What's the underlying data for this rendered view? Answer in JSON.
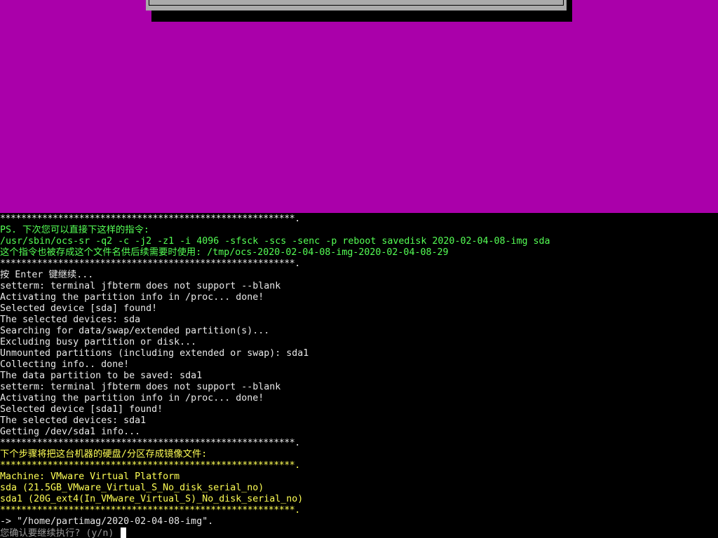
{
  "colors": {
    "dialog_background": "#aa00aa",
    "dialog_box": "#aaaaaa",
    "white": "#e8e8e8",
    "green": "#55ff55",
    "yellow": "#ffff55",
    "dim": "#9a9a9a"
  },
  "terminal": {
    "lines": [
      {
        "text": "********************************************************.",
        "color": "white"
      },
      {
        "text": "PS. 下次您可以直接下这样的指令:",
        "color": "green"
      },
      {
        "text": "/usr/sbin/ocs-sr -q2 -c -j2 -z1 -i 4096 -sfsck -scs -senc -p reboot savedisk 2020-02-04-08-img sda",
        "color": "green"
      },
      {
        "text": "这个指令也被存成这个文件名供后续需要时使用: /tmp/ocs-2020-02-04-08-img-2020-02-04-08-29",
        "color": "green"
      },
      {
        "text": "********************************************************.",
        "color": "white"
      },
      {
        "text": "按 Enter 键继续...",
        "color": "white"
      },
      {
        "text": "setterm: terminal jfbterm does not support --blank",
        "color": "white"
      },
      {
        "text": "Activating the partition info in /proc... done!",
        "color": "white"
      },
      {
        "text": "Selected device [sda] found!",
        "color": "white"
      },
      {
        "text": "The selected devices: sda",
        "color": "white"
      },
      {
        "text": "Searching for data/swap/extended partition(s)...",
        "color": "white"
      },
      {
        "text": "Excluding busy partition or disk...",
        "color": "white"
      },
      {
        "text": "Unmounted partitions (including extended or swap): sda1",
        "color": "white"
      },
      {
        "text": "Collecting info.. done!",
        "color": "white"
      },
      {
        "text": "The data partition to be saved: sda1",
        "color": "white"
      },
      {
        "text": "setterm: terminal jfbterm does not support --blank",
        "color": "white"
      },
      {
        "text": "Activating the partition info in /proc... done!",
        "color": "white"
      },
      {
        "text": "Selected device [sda1] found!",
        "color": "white"
      },
      {
        "text": "The selected devices: sda1",
        "color": "white"
      },
      {
        "text": "Getting /dev/sda1 info...",
        "color": "white"
      },
      {
        "text": "********************************************************.",
        "color": "white"
      },
      {
        "text": "下个步骤将把这台机器的硬盘/分区存成镜像文件:",
        "color": "yellow"
      },
      {
        "text": "********************************************************.",
        "color": "yellow"
      },
      {
        "text": "Machine: VMware Virtual Platform",
        "color": "yellow"
      },
      {
        "text": "sda (21.5GB_VMware_Virtual_S_No_disk_serial_no)",
        "color": "yellow"
      },
      {
        "text": "sda1 (20G_ext4(In_VMware_Virtual_S)_No_disk_serial_no)",
        "color": "yellow"
      },
      {
        "text": "********************************************************.",
        "color": "yellow"
      },
      {
        "text": "-> \"/home/partimag/2020-02-04-08-img\".",
        "color": "white"
      },
      {
        "text": "您确认要继续执行? (y/n) ",
        "color": "dim"
      }
    ]
  }
}
